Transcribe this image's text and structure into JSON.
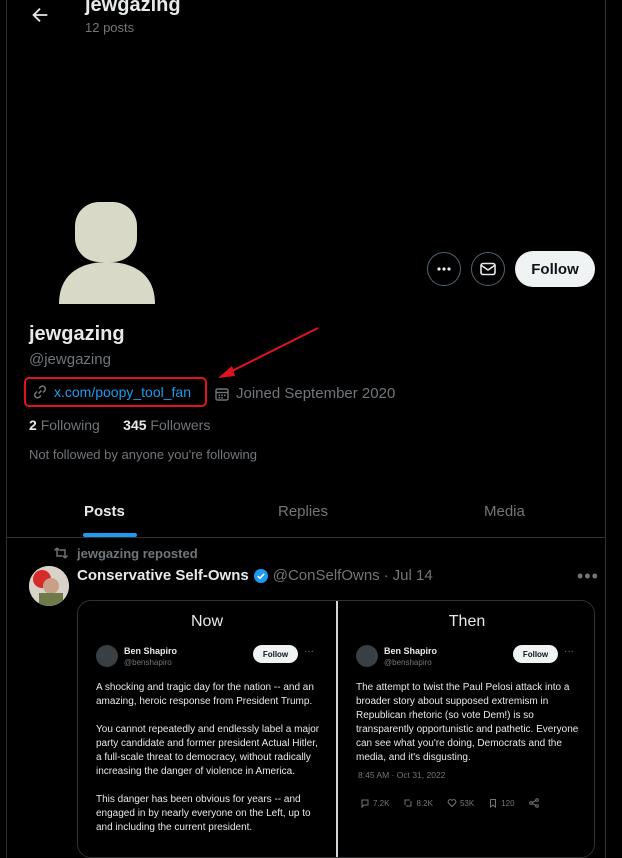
{
  "header": {
    "name": "jewgazing",
    "posts": "12 posts"
  },
  "profile": {
    "display_name": "jewgazing",
    "handle": "@jewgazing",
    "website": "x.com/poopy_tool_fan",
    "joined": "Joined September 2020",
    "following_count": "2",
    "following_label": "Following",
    "followers_count": "345",
    "followers_label": "Followers",
    "not_followed": "Not followed by anyone you're following"
  },
  "actions": {
    "follow": "Follow"
  },
  "tabs": [
    {
      "label": "Posts",
      "active": true
    },
    {
      "label": "Replies",
      "active": false
    },
    {
      "label": "Media",
      "active": false
    }
  ],
  "tweet": {
    "repost_label": "jewgazing reposted",
    "author_name": "Conservative Self-Owns",
    "author_handle": "@ConSelfOwns",
    "date": "Jul 14",
    "more": "•••",
    "media": {
      "left": {
        "title": "Now",
        "name": "Ben Shapiro",
        "handle": "@benshapiro",
        "follow": "Follow",
        "paragraphs": [
          "A shocking and tragic day for the nation -- and an amazing, heroic response from President Trump.",
          "You cannot repeatedly and endlessly label a major party candidate and former president Actual Hitler, a full-scale threat to democracy, without radically increasing the danger of violence in America.",
          "This danger has been obvious for years -- and engaged in by nearly everyone on the Left, up to and including the current president."
        ]
      },
      "right": {
        "title": "Then",
        "name": "Ben Shapiro",
        "handle": "@benshapiro",
        "follow": "Follow",
        "paragraphs": [
          "The attempt to twist the Paul Pelosi attack into a broader story about supposed extremism in Republican rhetoric (so vote Dem!) is so transparently opportunistic and pathetic. Everyone can see what you're doing, Democrats and the media, and it's disgusting."
        ],
        "time": "8:45 AM · Oct 31, 2022",
        "stats": {
          "replies": "7.2K",
          "reposts": "8.2K",
          "likes": "53K",
          "bookmarks": "120"
        }
      }
    }
  },
  "colors": {
    "accent": "#1d9bf0",
    "highlight_box": "#e0141e",
    "background": "#000000"
  }
}
